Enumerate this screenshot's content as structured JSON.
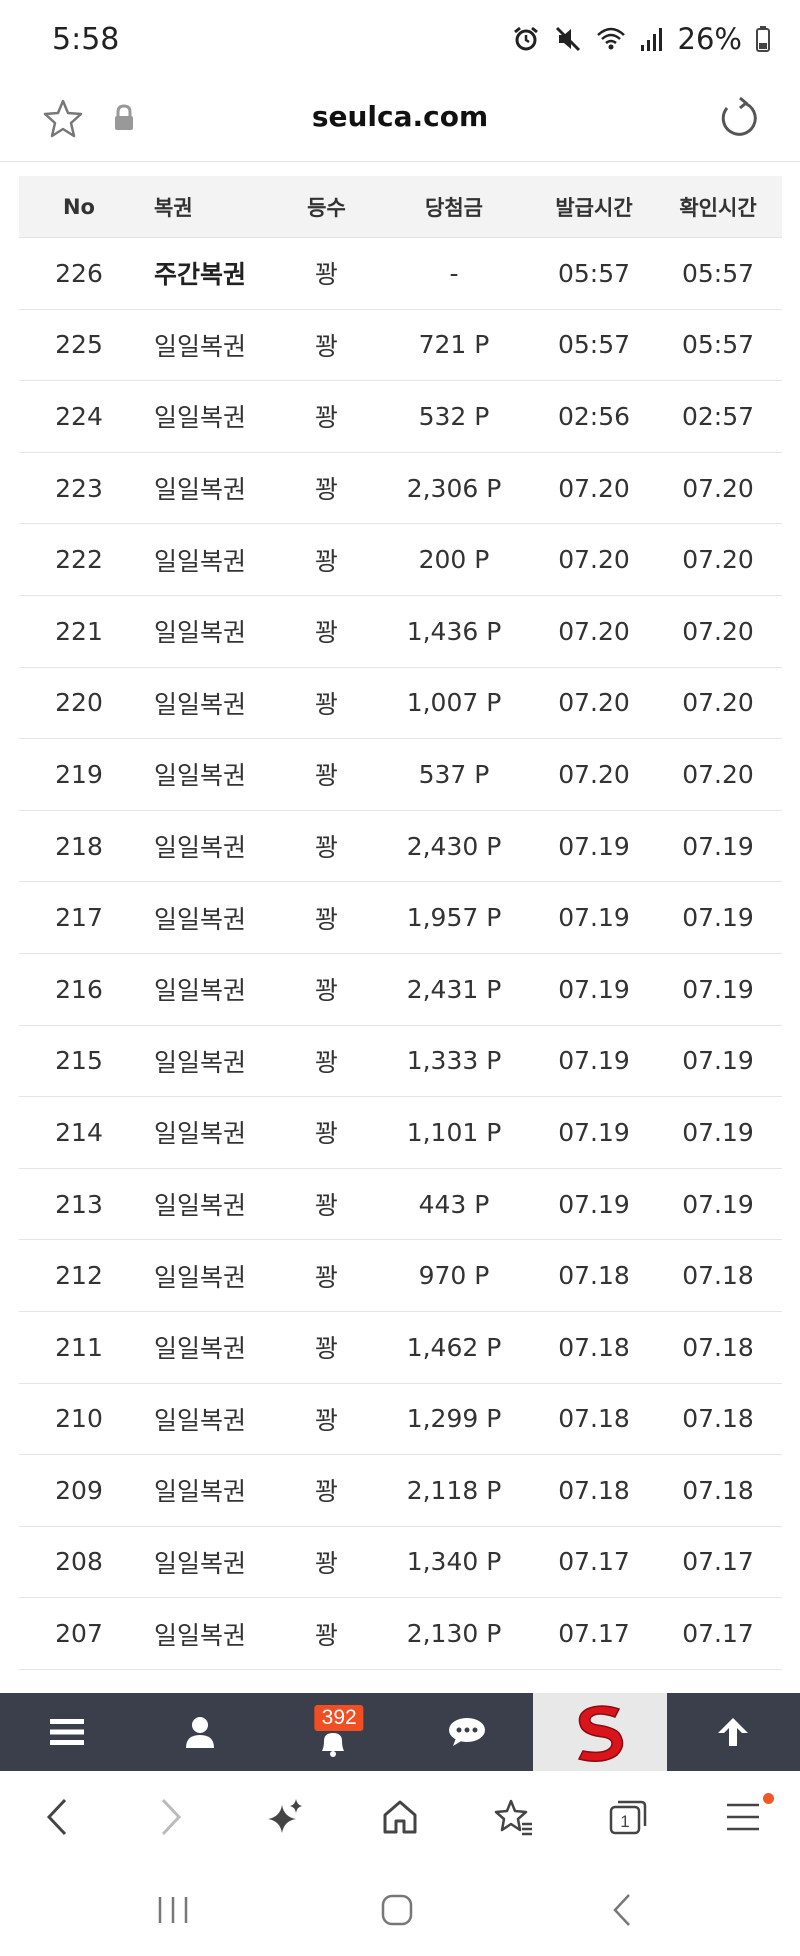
{
  "status_bar": {
    "time": "5:58",
    "battery": "26%"
  },
  "browser": {
    "url": "seulca.com"
  },
  "table": {
    "headers": {
      "no": "No",
      "name": "복권",
      "rank": "등수",
      "prize": "당첨금",
      "issue_time": "발급시간",
      "check_time": "확인시간"
    },
    "rows": [
      {
        "no": "226",
        "name": "주간복권",
        "rank": "꽝",
        "prize": "-",
        "issue": "05:57",
        "check": "05:57"
      },
      {
        "no": "225",
        "name": "일일복권",
        "rank": "꽝",
        "prize": "721 P",
        "issue": "05:57",
        "check": "05:57"
      },
      {
        "no": "224",
        "name": "일일복권",
        "rank": "꽝",
        "prize": "532 P",
        "issue": "02:56",
        "check": "02:57"
      },
      {
        "no": "223",
        "name": "일일복권",
        "rank": "꽝",
        "prize": "2,306 P",
        "issue": "07.20",
        "check": "07.20"
      },
      {
        "no": "222",
        "name": "일일복권",
        "rank": "꽝",
        "prize": "200 P",
        "issue": "07.20",
        "check": "07.20"
      },
      {
        "no": "221",
        "name": "일일복권",
        "rank": "꽝",
        "prize": "1,436 P",
        "issue": "07.20",
        "check": "07.20"
      },
      {
        "no": "220",
        "name": "일일복권",
        "rank": "꽝",
        "prize": "1,007 P",
        "issue": "07.20",
        "check": "07.20"
      },
      {
        "no": "219",
        "name": "일일복권",
        "rank": "꽝",
        "prize": "537 P",
        "issue": "07.20",
        "check": "07.20"
      },
      {
        "no": "218",
        "name": "일일복권",
        "rank": "꽝",
        "prize": "2,430 P",
        "issue": "07.19",
        "check": "07.19"
      },
      {
        "no": "217",
        "name": "일일복권",
        "rank": "꽝",
        "prize": "1,957 P",
        "issue": "07.19",
        "check": "07.19"
      },
      {
        "no": "216",
        "name": "일일복권",
        "rank": "꽝",
        "prize": "2,431 P",
        "issue": "07.19",
        "check": "07.19"
      },
      {
        "no": "215",
        "name": "일일복권",
        "rank": "꽝",
        "prize": "1,333 P",
        "issue": "07.19",
        "check": "07.19"
      },
      {
        "no": "214",
        "name": "일일복권",
        "rank": "꽝",
        "prize": "1,101 P",
        "issue": "07.19",
        "check": "07.19"
      },
      {
        "no": "213",
        "name": "일일복권",
        "rank": "꽝",
        "prize": "443 P",
        "issue": "07.19",
        "check": "07.19"
      },
      {
        "no": "212",
        "name": "일일복권",
        "rank": "꽝",
        "prize": "970 P",
        "issue": "07.18",
        "check": "07.18"
      },
      {
        "no": "211",
        "name": "일일복권",
        "rank": "꽝",
        "prize": "1,462 P",
        "issue": "07.18",
        "check": "07.18"
      },
      {
        "no": "210",
        "name": "일일복권",
        "rank": "꽝",
        "prize": "1,299 P",
        "issue": "07.18",
        "check": "07.18"
      },
      {
        "no": "209",
        "name": "일일복권",
        "rank": "꽝",
        "prize": "2,118 P",
        "issue": "07.18",
        "check": "07.18"
      },
      {
        "no": "208",
        "name": "일일복권",
        "rank": "꽝",
        "prize": "1,340 P",
        "issue": "07.17",
        "check": "07.17"
      },
      {
        "no": "207",
        "name": "일일복권",
        "rank": "꽝",
        "prize": "2,130 P",
        "issue": "07.17",
        "check": "07.17"
      }
    ]
  },
  "site_nav": {
    "notification_count": "392",
    "items": [
      "menu-icon",
      "user-icon",
      "bell-icon",
      "chat-icon",
      "site-logo",
      "arrow-up-icon"
    ]
  },
  "browser_bottom": {
    "items": [
      "back-icon",
      "forward-icon",
      "sparkle-icon",
      "home-icon",
      "bookmarks-icon",
      "tabs-icon",
      "menu-icon"
    ],
    "tab_count": "1"
  },
  "colors": {
    "site_nav_bg": "#3a3f4b",
    "badge": "#f04e23",
    "logo_red": "#d9141b",
    "header_bg": "#f3f3f3"
  }
}
